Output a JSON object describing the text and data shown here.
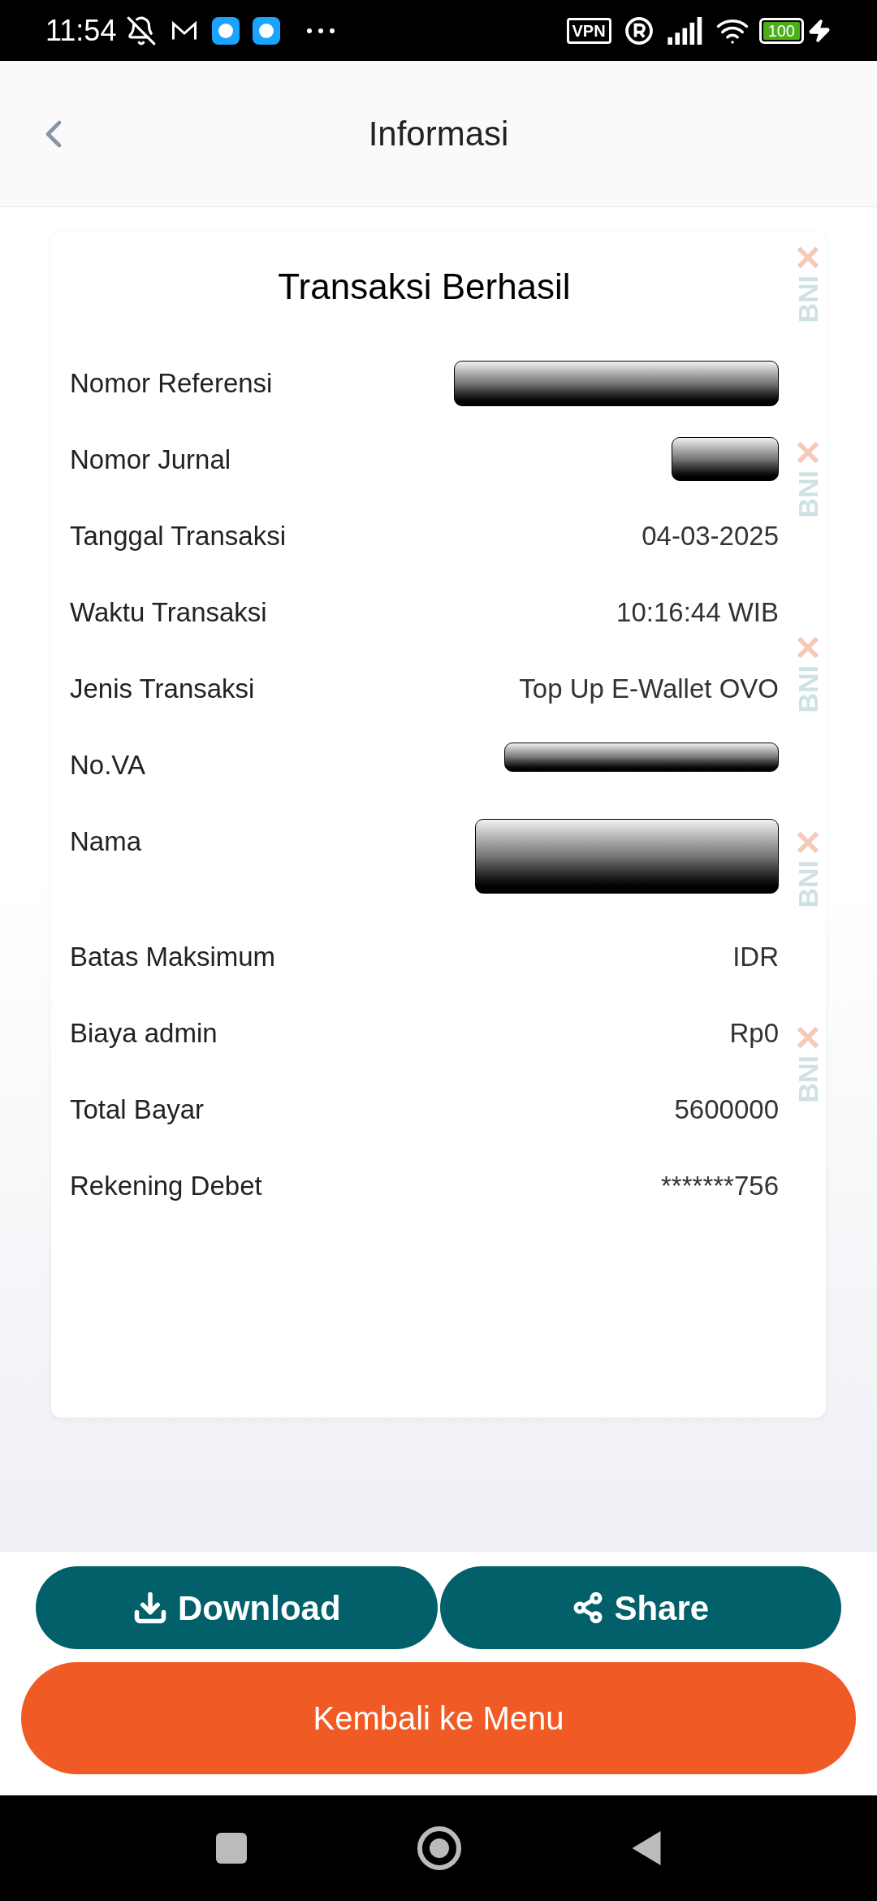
{
  "status_bar": {
    "time": "11:54",
    "vpn": "VPN",
    "battery": "100"
  },
  "header": {
    "title": "Informasi"
  },
  "card": {
    "title": "Transaksi Berhasil",
    "rows": [
      {
        "label": "Nomor Referensi",
        "kind": "redacted"
      },
      {
        "label": "Nomor Jurnal",
        "kind": "redacted"
      },
      {
        "label": "Tanggal Transaksi",
        "kind": "text",
        "value": "04-03-2025"
      },
      {
        "label": "Waktu Transaksi",
        "kind": "text",
        "value": "10:16:44 WIB"
      },
      {
        "label": "Jenis Transaksi",
        "kind": "text",
        "value": "Top Up E-Wallet OVO"
      },
      {
        "label": "No.VA",
        "kind": "redacted"
      },
      {
        "label": "Nama",
        "kind": "redacted"
      },
      {
        "label": "Batas Maksimum",
        "kind": "text",
        "value": "IDR"
      },
      {
        "label": "Biaya admin",
        "kind": "text",
        "value": "Rp0"
      },
      {
        "label": "Total Bayar",
        "kind": "text",
        "value": "5600000"
      },
      {
        "label": "Rekening Debet",
        "kind": "text",
        "value": "*******756"
      }
    ],
    "side_pattern": [
      "BNI",
      "BNI",
      "BNI",
      "BNI",
      "BNI"
    ]
  },
  "buttons": [
    {
      "label": "Download",
      "kind": "download"
    },
    {
      "label": "Share",
      "kind": "share"
    }
  ],
  "primary_button": {
    "label": "Kembali ke Menu"
  }
}
